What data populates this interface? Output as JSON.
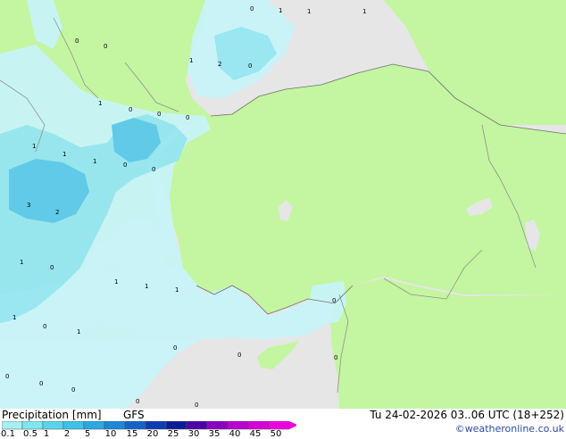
{
  "title": "Precipitation [mm]",
  "model": "GFS",
  "valid_time": "Tu 24-02-2026 03..06 UTC (18+252)",
  "credit": "©weatheronline.co.uk",
  "legend": {
    "ticks": [
      "0.1",
      "0.5",
      "1",
      "2",
      "5",
      "10",
      "15",
      "20",
      "25",
      "30",
      "35",
      "40",
      "45",
      "50"
    ],
    "colors": [
      "#a6f0f0",
      "#7ee6f0",
      "#5ad4ec",
      "#3cc2e6",
      "#2aa8e0",
      "#1c88d8",
      "#1464c8",
      "#0c3cb0",
      "#0a1c96",
      "#4c00a8",
      "#8c00c0",
      "#b800d0",
      "#d800d8",
      "#f000e0"
    ]
  },
  "map_values": [
    "0",
    "1",
    "1",
    "1",
    "0",
    "0",
    "1",
    "2",
    "0",
    "1",
    "0",
    "0",
    "0",
    "1",
    "1",
    "1",
    "0",
    "3",
    "2",
    "0",
    "1",
    "0",
    "1",
    "1",
    "1",
    "0",
    "1",
    "0",
    "1",
    "0",
    "0",
    "0",
    "0",
    "0",
    "0",
    "0",
    "0"
  ],
  "colors": {
    "land": "#c4f5a0",
    "sea": "#e6e6e6",
    "border": "#909090",
    "precip_light": "#c8f4f8",
    "precip_mid": "#96e6f2",
    "precip_heavy": "#5cc8ec"
  }
}
